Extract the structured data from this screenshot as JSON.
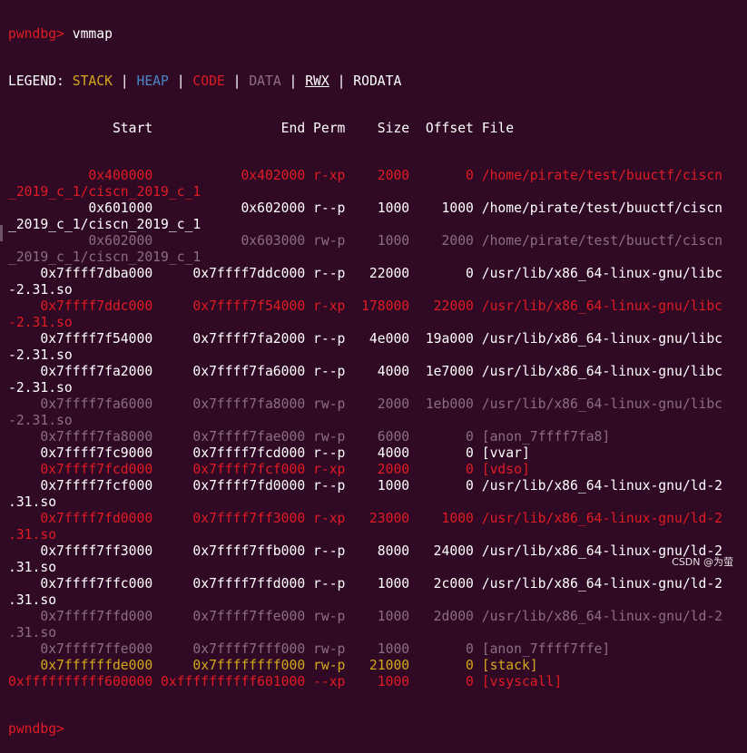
{
  "prompt": "pwndbg>",
  "command": "vmmap",
  "next_prompt": "pwndbg>",
  "legend": {
    "label": "LEGEND: ",
    "sep": " | ",
    "stack": "STACK",
    "heap": "HEAP",
    "code": "CODE",
    "data": "DATA",
    "rwx": "RWX",
    "rodata": "RODATA"
  },
  "header": {
    "start": "Start",
    "end": "End",
    "perm": "Perm",
    "size": "Size",
    "offset": "Offset",
    "file": "File"
  },
  "colors": {
    "background": "#300a24",
    "code": "#e01b24",
    "rodata": "#ffffff",
    "data": "#8a6e84",
    "stack": "#d4a81c",
    "heap": "#4a86c6"
  },
  "rows": [
    {
      "start": "0x400000",
      "end": "0x402000",
      "perm": "r-xp",
      "size": "2000",
      "offset": "0",
      "file": "/home/pirate/test/buuctf/ciscn",
      "file2": "_2019_c_1/ciscn_2019_c_1",
      "color": "red"
    },
    {
      "start": "0x601000",
      "end": "0x602000",
      "perm": "r--p",
      "size": "1000",
      "offset": "1000",
      "file": "/home/pirate/test/buuctf/ciscn",
      "file2": "_2019_c_1/ciscn_2019_c_1",
      "color": "white"
    },
    {
      "start": "0x602000",
      "end": "0x603000",
      "perm": "rw-p",
      "size": "1000",
      "offset": "2000",
      "file": "/home/pirate/test/buuctf/ciscn",
      "file2": "_2019_c_1/ciscn_2019_c_1",
      "color": "gray"
    },
    {
      "start": "0x7ffff7dba000",
      "end": "0x7ffff7ddc000",
      "perm": "r--p",
      "size": "22000",
      "offset": "0",
      "file": "/usr/lib/x86_64-linux-gnu/libc",
      "file2": "-2.31.so",
      "color": "white"
    },
    {
      "start": "0x7ffff7ddc000",
      "end": "0x7ffff7f54000",
      "perm": "r-xp",
      "size": "178000",
      "offset": "22000",
      "file": "/usr/lib/x86_64-linux-gnu/libc",
      "file2": "-2.31.so",
      "color": "red"
    },
    {
      "start": "0x7ffff7f54000",
      "end": "0x7ffff7fa2000",
      "perm": "r--p",
      "size": "4e000",
      "offset": "19a000",
      "file": "/usr/lib/x86_64-linux-gnu/libc",
      "file2": "-2.31.so",
      "color": "white"
    },
    {
      "start": "0x7ffff7fa2000",
      "end": "0x7ffff7fa6000",
      "perm": "r--p",
      "size": "4000",
      "offset": "1e7000",
      "file": "/usr/lib/x86_64-linux-gnu/libc",
      "file2": "-2.31.so",
      "color": "white"
    },
    {
      "start": "0x7ffff7fa6000",
      "end": "0x7ffff7fa8000",
      "perm": "rw-p",
      "size": "2000",
      "offset": "1eb000",
      "file": "/usr/lib/x86_64-linux-gnu/libc",
      "file2": "-2.31.so",
      "color": "gray"
    },
    {
      "start": "0x7ffff7fa8000",
      "end": "0x7ffff7fae000",
      "perm": "rw-p",
      "size": "6000",
      "offset": "0",
      "file": "[anon_7ffff7fa8]",
      "file2": "",
      "color": "gray"
    },
    {
      "start": "0x7ffff7fc9000",
      "end": "0x7ffff7fcd000",
      "perm": "r--p",
      "size": "4000",
      "offset": "0",
      "file": "[vvar]",
      "file2": "",
      "color": "white"
    },
    {
      "start": "0x7ffff7fcd000",
      "end": "0x7ffff7fcf000",
      "perm": "r-xp",
      "size": "2000",
      "offset": "0",
      "file": "[vdso]",
      "file2": "",
      "color": "red"
    },
    {
      "start": "0x7ffff7fcf000",
      "end": "0x7ffff7fd0000",
      "perm": "r--p",
      "size": "1000",
      "offset": "0",
      "file": "/usr/lib/x86_64-linux-gnu/ld-2",
      "file2": ".31.so",
      "color": "white"
    },
    {
      "start": "0x7ffff7fd0000",
      "end": "0x7ffff7ff3000",
      "perm": "r-xp",
      "size": "23000",
      "offset": "1000",
      "file": "/usr/lib/x86_64-linux-gnu/ld-2",
      "file2": ".31.so",
      "color": "red"
    },
    {
      "start": "0x7ffff7ff3000",
      "end": "0x7ffff7ffb000",
      "perm": "r--p",
      "size": "8000",
      "offset": "24000",
      "file": "/usr/lib/x86_64-linux-gnu/ld-2",
      "file2": ".31.so",
      "color": "white"
    },
    {
      "start": "0x7ffff7ffc000",
      "end": "0x7ffff7ffd000",
      "perm": "r--p",
      "size": "1000",
      "offset": "2c000",
      "file": "/usr/lib/x86_64-linux-gnu/ld-2",
      "file2": ".31.so",
      "color": "white"
    },
    {
      "start": "0x7ffff7ffd000",
      "end": "0x7ffff7ffe000",
      "perm": "rw-p",
      "size": "1000",
      "offset": "2d000",
      "file": "/usr/lib/x86_64-linux-gnu/ld-2",
      "file2": ".31.so",
      "color": "gray"
    },
    {
      "start": "0x7ffff7ffe000",
      "end": "0x7ffff7fff000",
      "perm": "rw-p",
      "size": "1000",
      "offset": "0",
      "file": "[anon_7ffff7ffe]",
      "file2": "",
      "color": "gray"
    },
    {
      "start": "0x7ffffffde000",
      "end": "0x7ffffffff000",
      "perm": "rw-p",
      "size": "21000",
      "offset": "0",
      "file": "[stack]",
      "file2": "",
      "color": "yellow"
    },
    {
      "start": "0xffffffffff600000",
      "end": "0xffffffffff601000",
      "perm": "--xp",
      "size": "1000",
      "offset": "0",
      "file": "[vsyscall]",
      "file2": "",
      "color": "red"
    }
  ],
  "watermark": "CSDN @为萤"
}
